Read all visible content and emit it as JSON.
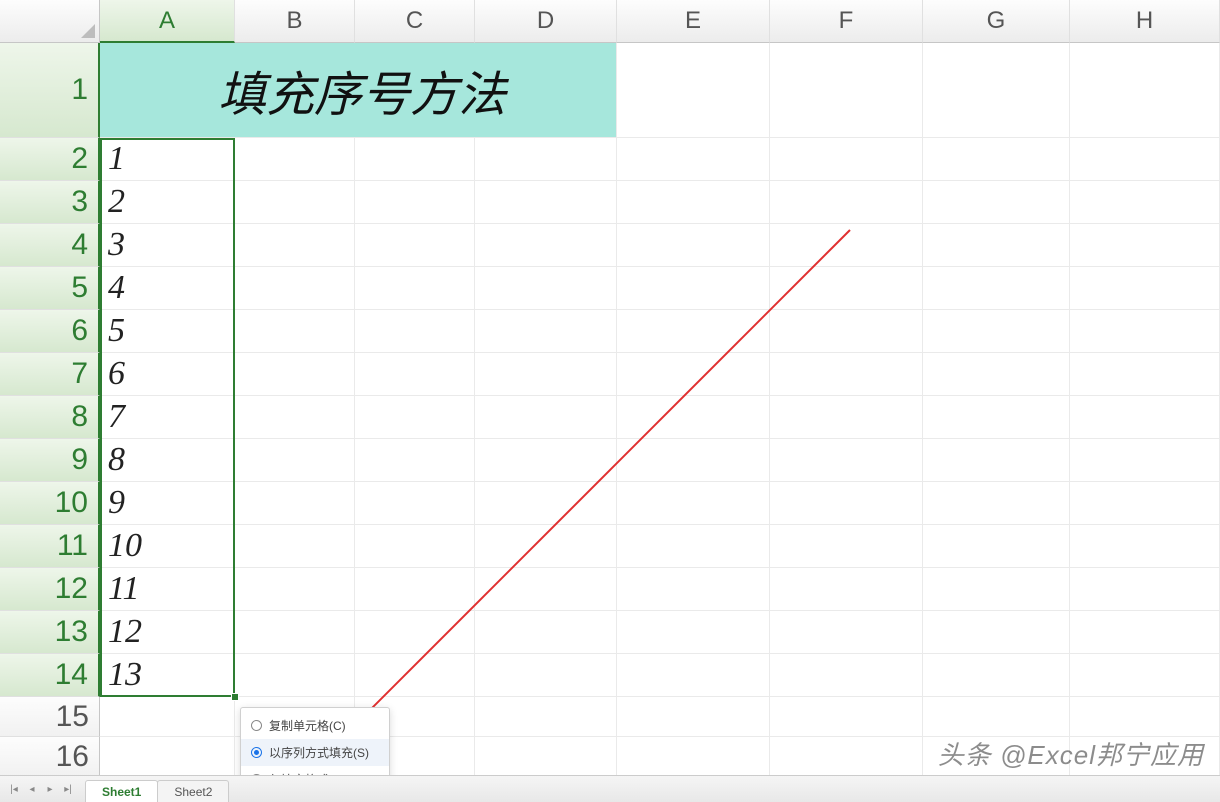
{
  "columns": [
    {
      "label": "A",
      "width": 135,
      "selected": true
    },
    {
      "label": "B",
      "width": 120,
      "selected": false
    },
    {
      "label": "C",
      "width": 120,
      "selected": false
    },
    {
      "label": "D",
      "width": 142,
      "selected": false
    },
    {
      "label": "E",
      "width": 153,
      "selected": false
    },
    {
      "label": "F",
      "width": 153,
      "selected": false
    },
    {
      "label": "G",
      "width": 147,
      "selected": false
    },
    {
      "label": "H",
      "width": 150,
      "selected": false
    }
  ],
  "rows": [
    {
      "num": "1",
      "height": 95,
      "selected": true
    },
    {
      "num": "2",
      "height": 43,
      "selected": true
    },
    {
      "num": "3",
      "height": 43,
      "selected": true
    },
    {
      "num": "4",
      "height": 43,
      "selected": true
    },
    {
      "num": "5",
      "height": 43,
      "selected": true
    },
    {
      "num": "6",
      "height": 43,
      "selected": true
    },
    {
      "num": "7",
      "height": 43,
      "selected": true
    },
    {
      "num": "8",
      "height": 43,
      "selected": true
    },
    {
      "num": "9",
      "height": 43,
      "selected": true
    },
    {
      "num": "10",
      "height": 43,
      "selected": true
    },
    {
      "num": "11",
      "height": 43,
      "selected": true
    },
    {
      "num": "12",
      "height": 43,
      "selected": true
    },
    {
      "num": "13",
      "height": 43,
      "selected": true
    },
    {
      "num": "14",
      "height": 43,
      "selected": true
    },
    {
      "num": "15",
      "height": 40,
      "selected": false
    },
    {
      "num": "16",
      "height": 40,
      "selected": false
    }
  ],
  "title_cell": {
    "text": "填充序号方法"
  },
  "data_values": [
    "1",
    "2",
    "3",
    "4",
    "5",
    "6",
    "7",
    "8",
    "9",
    "10",
    "11",
    "12",
    "13"
  ],
  "fill_menu": {
    "options": [
      {
        "label": "复制单元格(C)",
        "selected": false
      },
      {
        "label": "以序列方式填充(S)",
        "selected": true
      },
      {
        "label": "仅填充格式(F)",
        "selected": false
      }
    ]
  },
  "sheet_tabs": [
    {
      "name": "Sheet1",
      "active": true
    },
    {
      "name": "Sheet2",
      "active": false
    }
  ],
  "watermark": "头条 @Excel邦宁应用"
}
